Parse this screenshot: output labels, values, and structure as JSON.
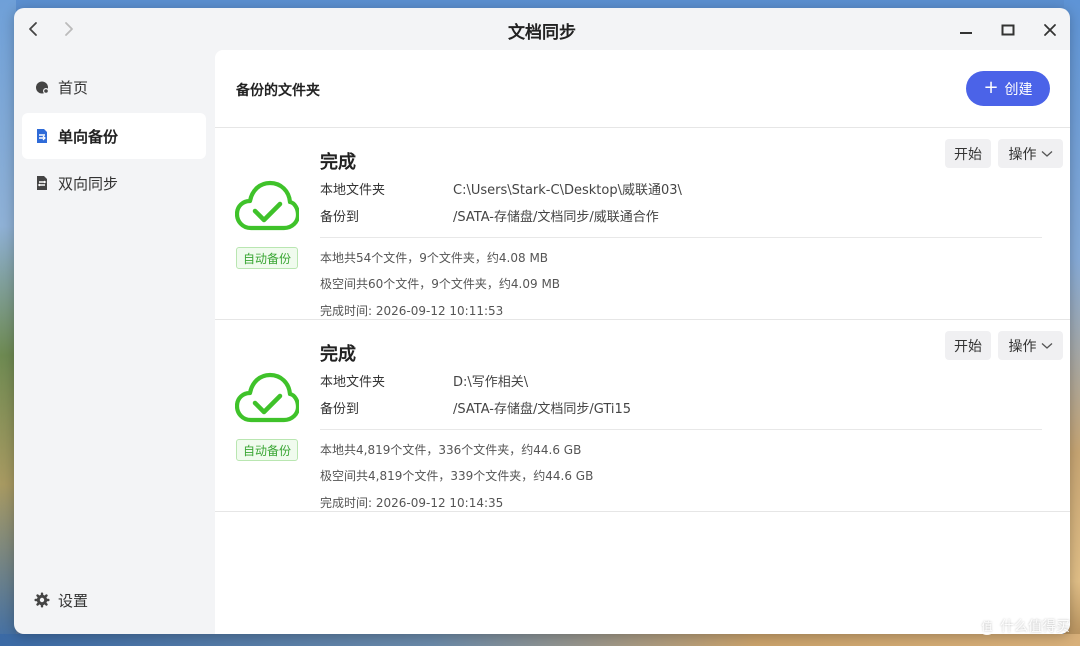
{
  "window": {
    "title": "文档同步"
  },
  "sidebar": {
    "items": [
      {
        "label": "首页",
        "icon": "home-icon"
      },
      {
        "label": "单向备份",
        "icon": "one-way-backup-icon"
      },
      {
        "label": "双向同步",
        "icon": "two-way-sync-icon"
      }
    ],
    "settings_label": "设置"
  },
  "main": {
    "section_title": "备份的文件夹",
    "create_label": "创建"
  },
  "tasks": [
    {
      "status": "完成",
      "local_label": "本地文件夹",
      "local_path": "C:\\Users\\Stark-C\\Desktop\\威联通03\\",
      "dest_label": "备份到",
      "dest_path": "/SATA-存储盘/文档同步/威联通合作",
      "local_stats": "本地共54个文件，9个文件夹，约4.08 MB",
      "remote_stats": "极空间共60个文件，9个文件夹，约4.09 MB",
      "finished": "完成时间: 2026-09-12 10:11:53",
      "badge": "自动备份",
      "start_label": "开始",
      "ops_label": "操作"
    },
    {
      "status": "完成",
      "local_label": "本地文件夹",
      "local_path": "D:\\写作相关\\",
      "dest_label": "备份到",
      "dest_path": "/SATA-存储盘/文档同步/GTi15",
      "local_stats": "本地共4,819个文件，336个文件夹，约44.6 GB",
      "remote_stats": "极空间共4,819个文件，339个文件夹，约44.6 GB",
      "finished": "完成时间: 2026-09-12 10:14:35",
      "badge": "自动备份",
      "start_label": "开始",
      "ops_label": "操作"
    }
  ],
  "watermark": {
    "circle": "值",
    "text": "什么值得买"
  },
  "colors": {
    "accent": "#4b63e8",
    "success": "#3fc22a",
    "badge_text": "#3aa634"
  }
}
